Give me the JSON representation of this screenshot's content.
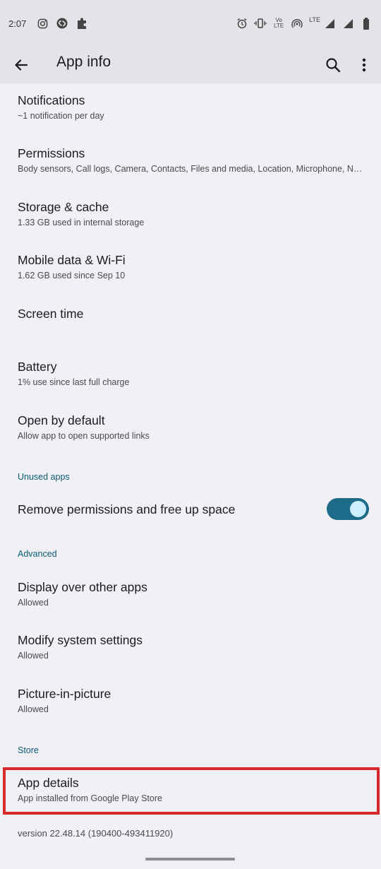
{
  "status_bar": {
    "time": "2:07",
    "volte_label_top": "Vo",
    "volte_label_bottom": "LTE",
    "network_label": "LTE",
    "icons": [
      "instagram-icon",
      "shazam-icon",
      "puzzle-icon",
      "alarm-icon",
      "vibrate-icon",
      "volte-icon",
      "hotspot-icon",
      "signal-icon",
      "signal-icon",
      "battery-icon"
    ]
  },
  "app_bar": {
    "title": "App info",
    "back_icon": "arrow-back-icon",
    "search_icon": "search-icon",
    "more_icon": "more-vert-icon"
  },
  "items": {
    "notifications": {
      "title": "Notifications",
      "subtitle": "~1 notification per day"
    },
    "permissions": {
      "title": "Permissions",
      "subtitle": "Body sensors, Call logs, Camera, Contacts, Files and media, Location, Microphone, Near…"
    },
    "storage": {
      "title": "Storage & cache",
      "subtitle": "1.33 GB used in internal storage"
    },
    "mobile_data": {
      "title": "Mobile data & Wi-Fi",
      "subtitle": "1.62 GB used since Sep 10"
    },
    "screen_time": {
      "title": "Screen time"
    },
    "battery": {
      "title": "Battery",
      "subtitle": "1% use since last full charge"
    },
    "open_default": {
      "title": "Open by default",
      "subtitle": "Allow app to open supported links"
    },
    "remove_permissions": {
      "title": "Remove permissions and free up space",
      "toggle_on": true
    },
    "display_over": {
      "title": "Display over other apps",
      "subtitle": "Allowed"
    },
    "modify_settings": {
      "title": "Modify system settings",
      "subtitle": "Allowed"
    },
    "pip": {
      "title": "Picture-in-picture",
      "subtitle": "Allowed"
    },
    "app_details": {
      "title": "App details",
      "subtitle": "App installed from Google Play Store"
    }
  },
  "sections": {
    "unused_apps": "Unused apps",
    "advanced": "Advanced",
    "store": "Store"
  },
  "version": "version 22.48.14 (190400-493411920)",
  "colors": {
    "background": "#f1f0f5",
    "bar": "#e3e3e8",
    "accent": "#0a5a73",
    "toggle_track": "#1c6c89",
    "highlight": "#d62a2a"
  }
}
